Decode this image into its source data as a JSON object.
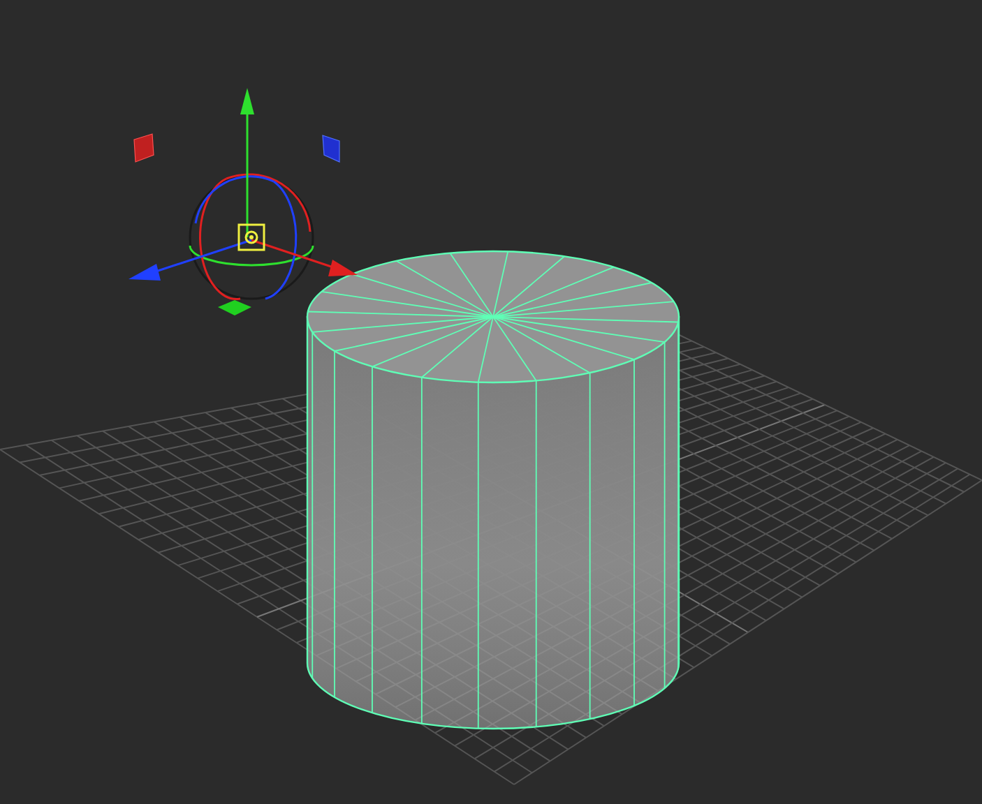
{
  "cylinder": {
    "selected": true
  }
}
